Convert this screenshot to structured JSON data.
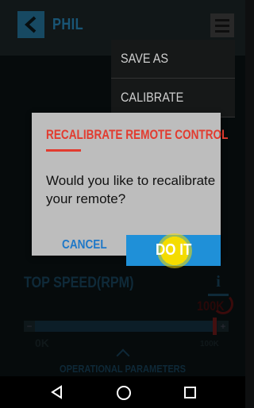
{
  "header": {
    "title": "PHIL"
  },
  "menu": {
    "items": [
      "SAVE AS",
      "CALIBRATE"
    ]
  },
  "dialog": {
    "title": "RECALIBRATE REMOTE CONTROL",
    "message": "Would you like to recalibrate your remote?",
    "cancel_label": "CANCEL",
    "confirm_label": "DO IT"
  },
  "parameter": {
    "label": "TOP SPEED(RPM)",
    "info_label": "i",
    "current_value": "100K",
    "min_label": "0K",
    "max_label": "100K",
    "level_fraction": 0.93
  },
  "footer": {
    "section_label": "OPERATIONAL PARAMETERS"
  },
  "colors": {
    "accent": "#1f90d8",
    "title_red": "#e23b2f",
    "highlight": "#f4dc00"
  },
  "icons": [
    "back-arrow-icon",
    "hamburger-menu-icon",
    "chevron-up-icon",
    "nav-back-icon",
    "nav-home-icon",
    "nav-recents-icon"
  ]
}
